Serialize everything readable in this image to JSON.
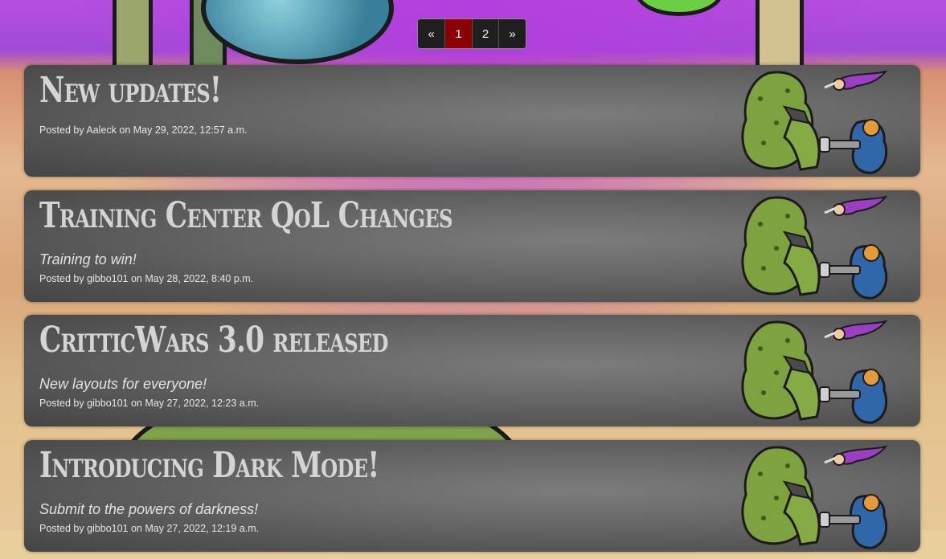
{
  "pagination": {
    "prev": "«",
    "pages": [
      "1",
      "2"
    ],
    "current": "1",
    "next": "»"
  },
  "posts": [
    {
      "title": "New updates!",
      "subtitle": "",
      "meta": "Posted by Aaleck on May 29, 2022, 12:57 a.m."
    },
    {
      "title": "Training Center QoL Changes",
      "subtitle": "Training to win!",
      "meta": "Posted by gibbo101 on May 28, 2022, 8:40 p.m."
    },
    {
      "title": "CritticWars 3.0 released",
      "subtitle": "New layouts for everyone!",
      "meta": "Posted by gibbo101 on May 27, 2022, 12:23 a.m."
    },
    {
      "title": "Introducing Dark Mode!",
      "subtitle": "Submit to the powers of darkness!",
      "meta": "Posted by gibbo101 on May 27, 2022, 12:19 a.m."
    }
  ],
  "colors": {
    "active_page": "#8b0000",
    "card_bg": "#6a6a6a"
  }
}
